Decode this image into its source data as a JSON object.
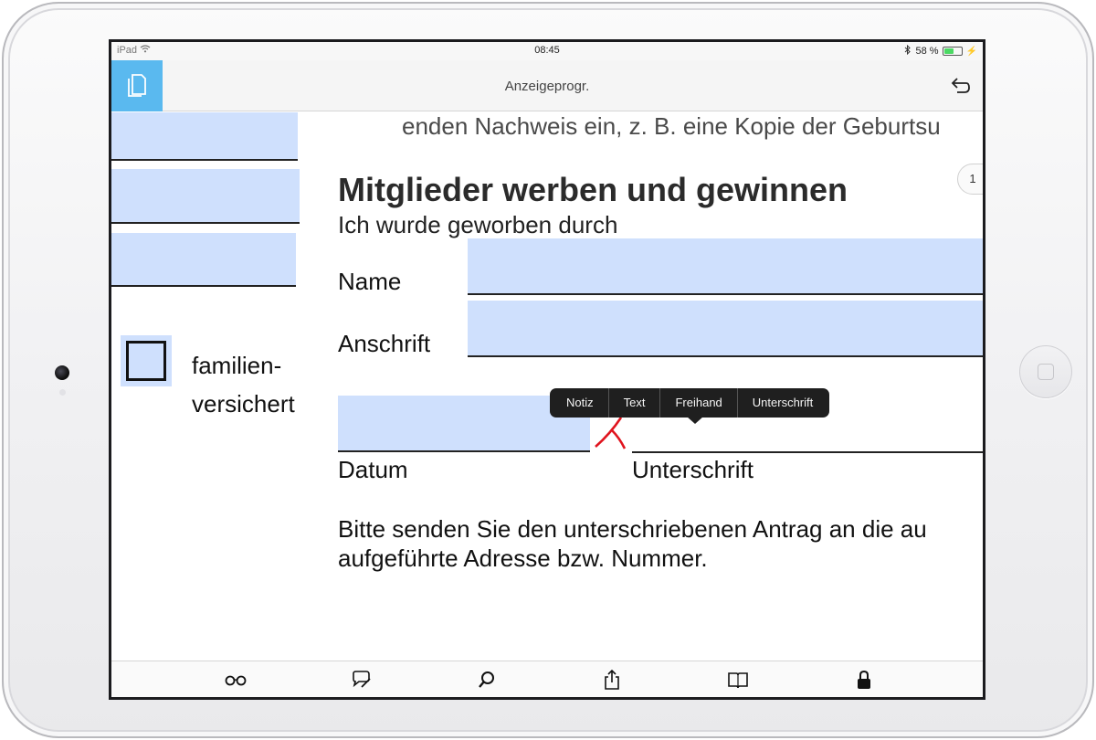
{
  "status_bar": {
    "device_label": "iPad",
    "time": "08:45",
    "battery_percent": "58 %",
    "battery_level": 0.58
  },
  "nav": {
    "title": "Anzeigeprogr."
  },
  "document": {
    "top_cut_text": "enden Nachweis ein, z. B. eine Kopie der Geburtsu",
    "checkbox_label_line1": "familien-",
    "checkbox_label_line2": "versichert",
    "section_title": "Mitglieder werben und gewinnen",
    "page_indicator": "1",
    "subtitle": "Ich wurde geworben durch",
    "name_label": "Name",
    "address_label": "Anschrift",
    "date_label": "Datum",
    "signature_label": "Unterschrift",
    "paragraph_line1": "Bitte senden Sie den unterschriebenen Antrag an die au",
    "paragraph_line2": "aufgeführte Adresse bzw. Nummer."
  },
  "popover_menu": {
    "items": [
      "Notiz",
      "Text",
      "Freihand",
      "Unterschrift"
    ]
  },
  "toolbar": {
    "icons": [
      "glasses-icon",
      "comment-icon",
      "search-icon",
      "share-icon",
      "book-icon",
      "lock-icon"
    ]
  },
  "colors": {
    "accent": "#5ab9ef",
    "field_fill": "#cfe0fd",
    "signature_mark": "#e0141e",
    "popover_bg": "#1f1f1f"
  }
}
